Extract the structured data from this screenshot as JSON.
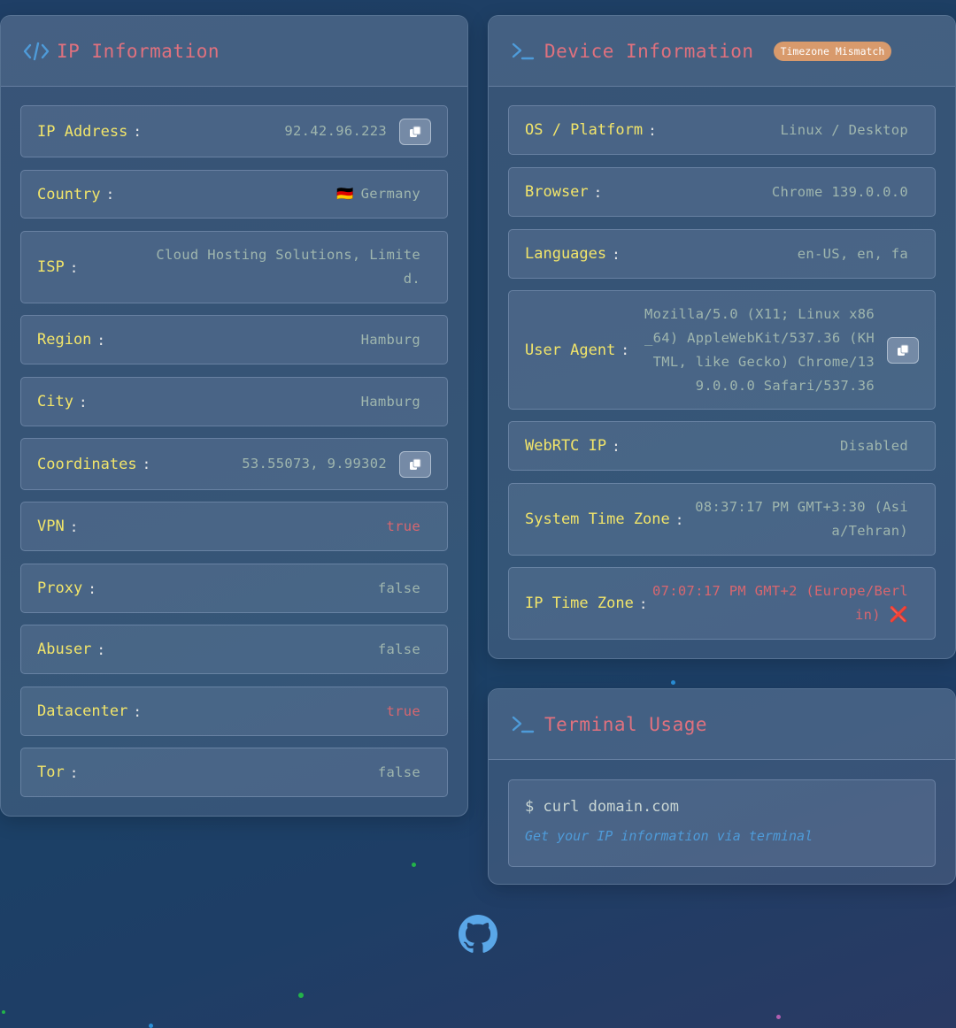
{
  "ip_card": {
    "title": "IP Information",
    "icon": "code-icon",
    "rows": [
      {
        "label": "IP Address",
        "value": "92.42.96.223",
        "copy": true
      },
      {
        "label": "Country",
        "value": "Germany",
        "flag": "🇩🇪"
      },
      {
        "label": "ISP",
        "value": "Cloud Hosting Solutions, Limited."
      },
      {
        "label": "Region",
        "value": "Hamburg"
      },
      {
        "label": "City",
        "value": "Hamburg"
      },
      {
        "label": "Coordinates",
        "value": "53.55073, 9.99302",
        "copy": true
      },
      {
        "label": "VPN",
        "value": "true"
      },
      {
        "label": "Proxy",
        "value": "false"
      },
      {
        "label": "Abuser",
        "value": "false"
      },
      {
        "label": "Datacenter",
        "value": "true"
      },
      {
        "label": "Tor",
        "value": "false"
      }
    ]
  },
  "device_card": {
    "title": "Device Information",
    "icon": "terminal-icon",
    "badge": "Timezone Mismatch",
    "rows": [
      {
        "label": "OS / Platform",
        "value": "Linux / Desktop"
      },
      {
        "label": "Browser",
        "value": "Chrome 139.0.0.0"
      },
      {
        "label": "Languages",
        "value": "en-US, en, fa"
      },
      {
        "label": "User Agent",
        "value": "Mozilla/5.0 (X11; Linux x86_64) AppleWebKit/537.36 (KHTML, like Gecko) Chrome/139.0.0.0 Safari/537.36",
        "copy": true
      },
      {
        "label": "WebRTC IP",
        "value": "Disabled"
      },
      {
        "label": "System Time Zone",
        "value": "08:37:17 PM GMT+3:30 (Asia/Tehran)"
      },
      {
        "label": "IP Time Zone",
        "value": "07:07:17 PM GMT+2 (Europe/Berlin)",
        "mark": "❌"
      }
    ]
  },
  "terminal_card": {
    "title": "Terminal Usage",
    "icon": "terminal-icon",
    "command": "$ curl domain.com",
    "description": "Get your IP information via terminal"
  },
  "footer": {
    "icon": "github-icon"
  },
  "colors": {
    "title": "#e0717e",
    "label": "#f2e56a",
    "value": "#9fb6ae",
    "warning": "#d7666f",
    "accent": "#4e9bd9",
    "badge": "#d89a6c"
  }
}
